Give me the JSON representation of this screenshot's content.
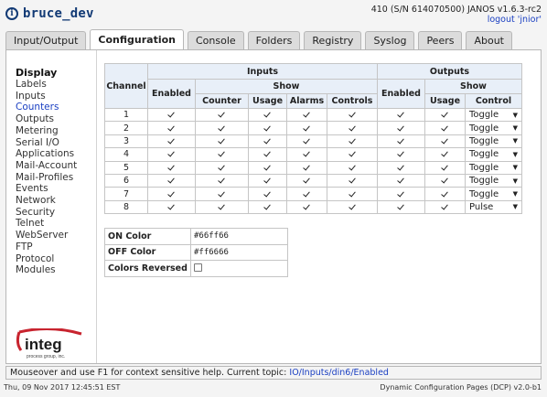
{
  "header": {
    "title": "bruce_dev",
    "device": "410 (S/N 614070500) JANOS v1.6.3-rc2",
    "logout": "logout 'jnior'"
  },
  "tabs": [
    {
      "label": "Input/Output"
    },
    {
      "label": "Configuration",
      "active": true
    },
    {
      "label": "Console"
    },
    {
      "label": "Folders"
    },
    {
      "label": "Registry"
    },
    {
      "label": "Syslog"
    },
    {
      "label": "Peers"
    },
    {
      "label": "About"
    }
  ],
  "sidebar": {
    "title": "Display",
    "items": [
      "Labels",
      "Inputs",
      "Counters",
      "Outputs",
      "Metering",
      "Serial I/O",
      "Applications",
      "Mail-Account",
      "Mail-Profiles",
      "Events",
      "Network",
      "Security",
      "Telnet",
      "WebServer",
      "FTP",
      "Protocol",
      "Modules"
    ],
    "active": "Counters"
  },
  "logo": {
    "name": "integ",
    "tagline": "process group, inc."
  },
  "table": {
    "headers": {
      "channel": "Channel",
      "inputs": "Inputs",
      "outputs": "Outputs",
      "enabled": "Enabled",
      "show": "Show",
      "counter": "Counter",
      "usage": "Usage",
      "alarms": "Alarms",
      "controls": "Controls",
      "control": "Control"
    },
    "rows": [
      {
        "channel": "1",
        "control": "Toggle"
      },
      {
        "channel": "2",
        "control": "Toggle"
      },
      {
        "channel": "3",
        "control": "Toggle"
      },
      {
        "channel": "4",
        "control": "Toggle"
      },
      {
        "channel": "5",
        "control": "Toggle"
      },
      {
        "channel": "6",
        "control": "Toggle"
      },
      {
        "channel": "7",
        "control": "Toggle"
      },
      {
        "channel": "8",
        "control": "Pulse"
      }
    ]
  },
  "colors": {
    "on_label": "ON Color",
    "on_value": "#66ff66",
    "off_label": "OFF Color",
    "off_value": "#ff6666",
    "reversed_label": "Colors Reversed"
  },
  "status": {
    "text": "Mouseover and use F1 for context sensitive help. Current topic:",
    "topic": "IO/Inputs/din6/Enabled"
  },
  "footer": {
    "timestamp": "Thu, 09 Nov 2017 12:45:51 EST",
    "version": "Dynamic Configuration Pages (DCP) v2.0-b1"
  },
  "palette": {
    "brand": "#123a75",
    "link": "#1a3fc2",
    "header_bg": "#e8eff8",
    "logo_red": "#c8242f"
  }
}
